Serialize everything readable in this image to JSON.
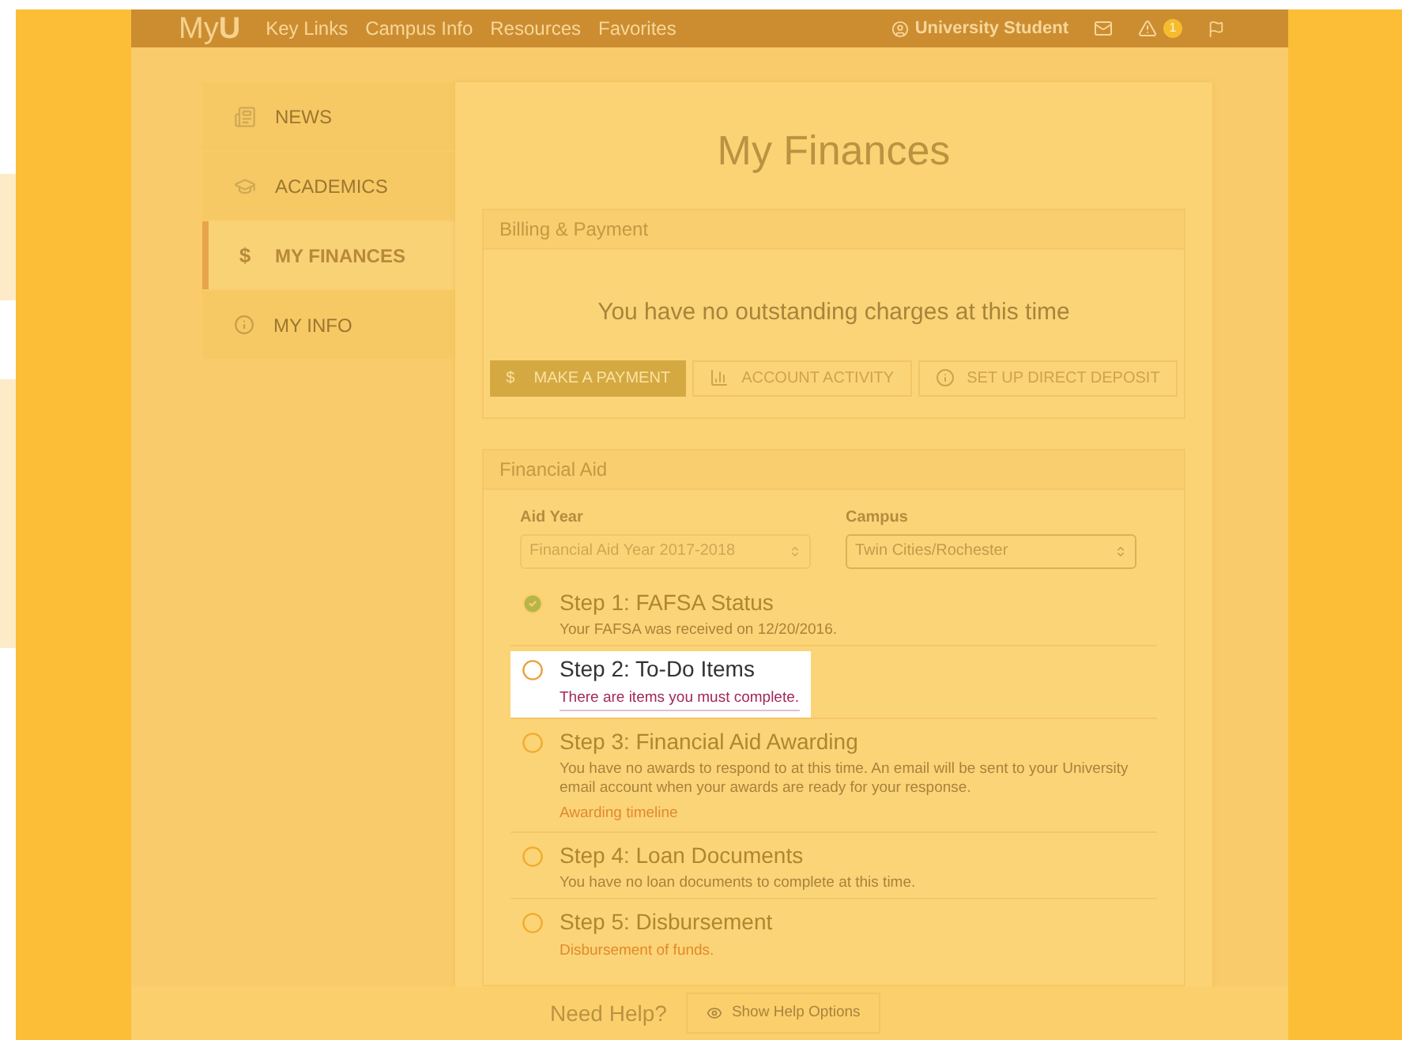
{
  "navbar": {
    "logo": "My**U**",
    "links": [
      "Key Links",
      "Campus Info",
      "Resources",
      "Favorites"
    ],
    "user": "University Student",
    "alert_count": "1"
  },
  "sidebar": {
    "items": [
      {
        "kind": "news",
        "label": "NEWS",
        "selected": false
      },
      {
        "kind": "academics",
        "label": "ACADEMICS",
        "selected": false
      },
      {
        "kind": "glyph",
        "glyph": "$",
        "label": "MY FINANCES",
        "selected": true
      },
      {
        "kind": "info",
        "label": "MY INFO",
        "selected": false
      }
    ]
  },
  "page_title": "My Finances",
  "billing": {
    "title": "Billing & Payment",
    "message": "You have no outstanding charges at this time",
    "buttons": [
      {
        "kind": "primary",
        "glyph": "$",
        "label": "MAKE A PAYMENT"
      },
      {
        "kind": "chart",
        "label": "ACCOUNT ACTIVITY"
      },
      {
        "kind": "info",
        "label": "SET UP DIRECT DEPOSIT"
      }
    ]
  },
  "financial_aid": {
    "title": "Financial Aid",
    "selects": [
      {
        "label": "Aid Year",
        "value": "Financial Aid Year 2017-2018"
      },
      {
        "label": "Campus",
        "value": "Twin Cities/Rochester"
      }
    ],
    "steps": [
      {
        "title": "Step 1: FAFSA Status",
        "complete": true,
        "highlighted": false,
        "description": "Your FAFSA was received on 12/20/2016."
      },
      {
        "title": "Step 2: To-Do Items",
        "complete": false,
        "highlighted": true,
        "link": "There are items you must complete."
      },
      {
        "title": "Step 3: Financial Aid Awarding",
        "complete": false,
        "highlighted": false,
        "description": "You have no awards to respond to at this time. An email will be sent to your University email account when your awards are ready for your response.",
        "link": "Awarding timeline"
      },
      {
        "title": "Step 4: Loan Documents",
        "complete": false,
        "highlighted": false,
        "description": "You have no loan documents to complete at this time."
      },
      {
        "title": "Step 5: Disbursement",
        "complete": false,
        "highlighted": false,
        "link": "Disbursement of funds."
      }
    ]
  },
  "help": {
    "label": "Need Help?",
    "button": "Show Help Options"
  }
}
